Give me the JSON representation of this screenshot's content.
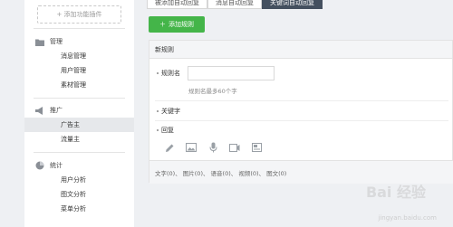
{
  "sidebar": {
    "add_plugin": "+ 添加功能插件",
    "groups": [
      {
        "title": "管理",
        "icon": "folder-icon",
        "items": [
          "消息管理",
          "用户管理",
          "素材管理"
        ]
      },
      {
        "title": "推广",
        "icon": "megaphone-icon",
        "items": [
          "广告主",
          "流量主"
        ]
      },
      {
        "title": "统计",
        "icon": "pie-chart-icon",
        "items": [
          "用户分析",
          "图文分析",
          "菜单分析"
        ]
      }
    ],
    "active_item": "广告主"
  },
  "tabs": [
    "被添加自动回复",
    "消息自动回复",
    "关键词自动回复"
  ],
  "active_tab": "关键词自动回复",
  "add_rule_label": "添加规则",
  "panel": {
    "title": "新规则",
    "rule_name_label": "规则名",
    "rule_name_value": "",
    "rule_name_hint": "规则名最多60个字",
    "keyword_label": "关键字",
    "reply_label": "回复",
    "toolbar_icons": [
      "pencil-icon",
      "image-icon",
      "microphone-icon",
      "video-icon",
      "article-icon"
    ],
    "counts_text": "文字(0)、 图片(0)、 语音(0)、 视频(0)、 图文(0)"
  },
  "watermark": {
    "logo_text": "Bai 经验",
    "url": "jingyan.baidu.com"
  },
  "colors": {
    "accent_green": "#44b549",
    "tab_active_bg": "#44505f"
  }
}
